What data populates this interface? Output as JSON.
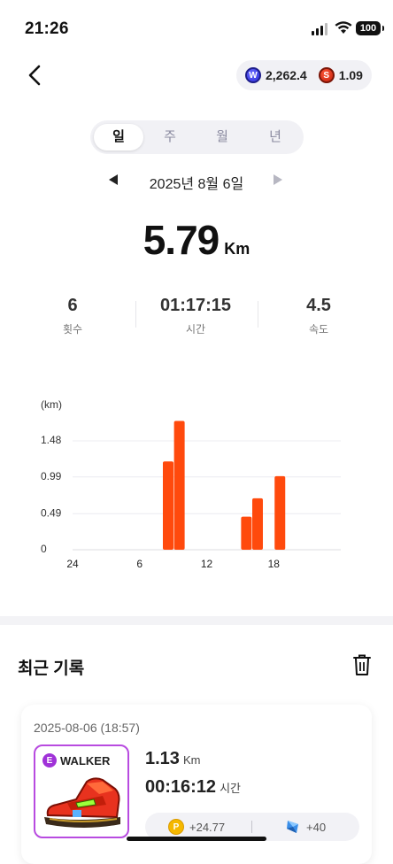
{
  "status_bar": {
    "time": "21:26",
    "battery": "100"
  },
  "header": {
    "balances": [
      {
        "icon": "w-token-icon",
        "value": "2,262.4"
      },
      {
        "icon": "s-token-icon",
        "value": "1.09"
      }
    ]
  },
  "period_tabs": [
    "일",
    "주",
    "월",
    "년"
  ],
  "active_tab": "일",
  "date_nav": {
    "date": "2025년 8월 6일"
  },
  "summary": {
    "distance": "5.79",
    "distance_unit": "Km"
  },
  "stats": [
    {
      "value": "6",
      "label": "횟수"
    },
    {
      "value": "01:17:15",
      "label": "시간"
    },
    {
      "value": "4.5",
      "label": "속도"
    }
  ],
  "chart_data": {
    "type": "bar",
    "ylabel": "(km)",
    "yticks": [
      0,
      0.49,
      0.99,
      1.48
    ],
    "ytick_labels": [
      "0",
      "0.49",
      "0.99",
      "1.48"
    ],
    "ylim": [
      0,
      1.48
    ],
    "xlim": [
      0,
      24
    ],
    "xticks": [
      0,
      6,
      12,
      18
    ],
    "xtick_labels": [
      "24",
      "6",
      "12",
      "18"
    ],
    "grid": true,
    "bar_color": "#ff4a0d",
    "x": [
      8,
      9,
      15,
      16,
      18
    ],
    "values": [
      1.2,
      1.75,
      0.45,
      0.7,
      1.0
    ]
  },
  "recent": {
    "title": "최근 기록",
    "records": [
      {
        "date": "2025-08-06 (18:57)",
        "shoe_grade": "E",
        "shoe_name": "WALKER",
        "distance": "1.13",
        "distance_unit": "Km",
        "duration": "00:16:12",
        "duration_unit": "시간",
        "reward_points": "+24.77",
        "reward_gems": "+40"
      }
    ]
  },
  "colors": {
    "accent": "#ff4a0d",
    "shoe_border": "#b84be0"
  }
}
